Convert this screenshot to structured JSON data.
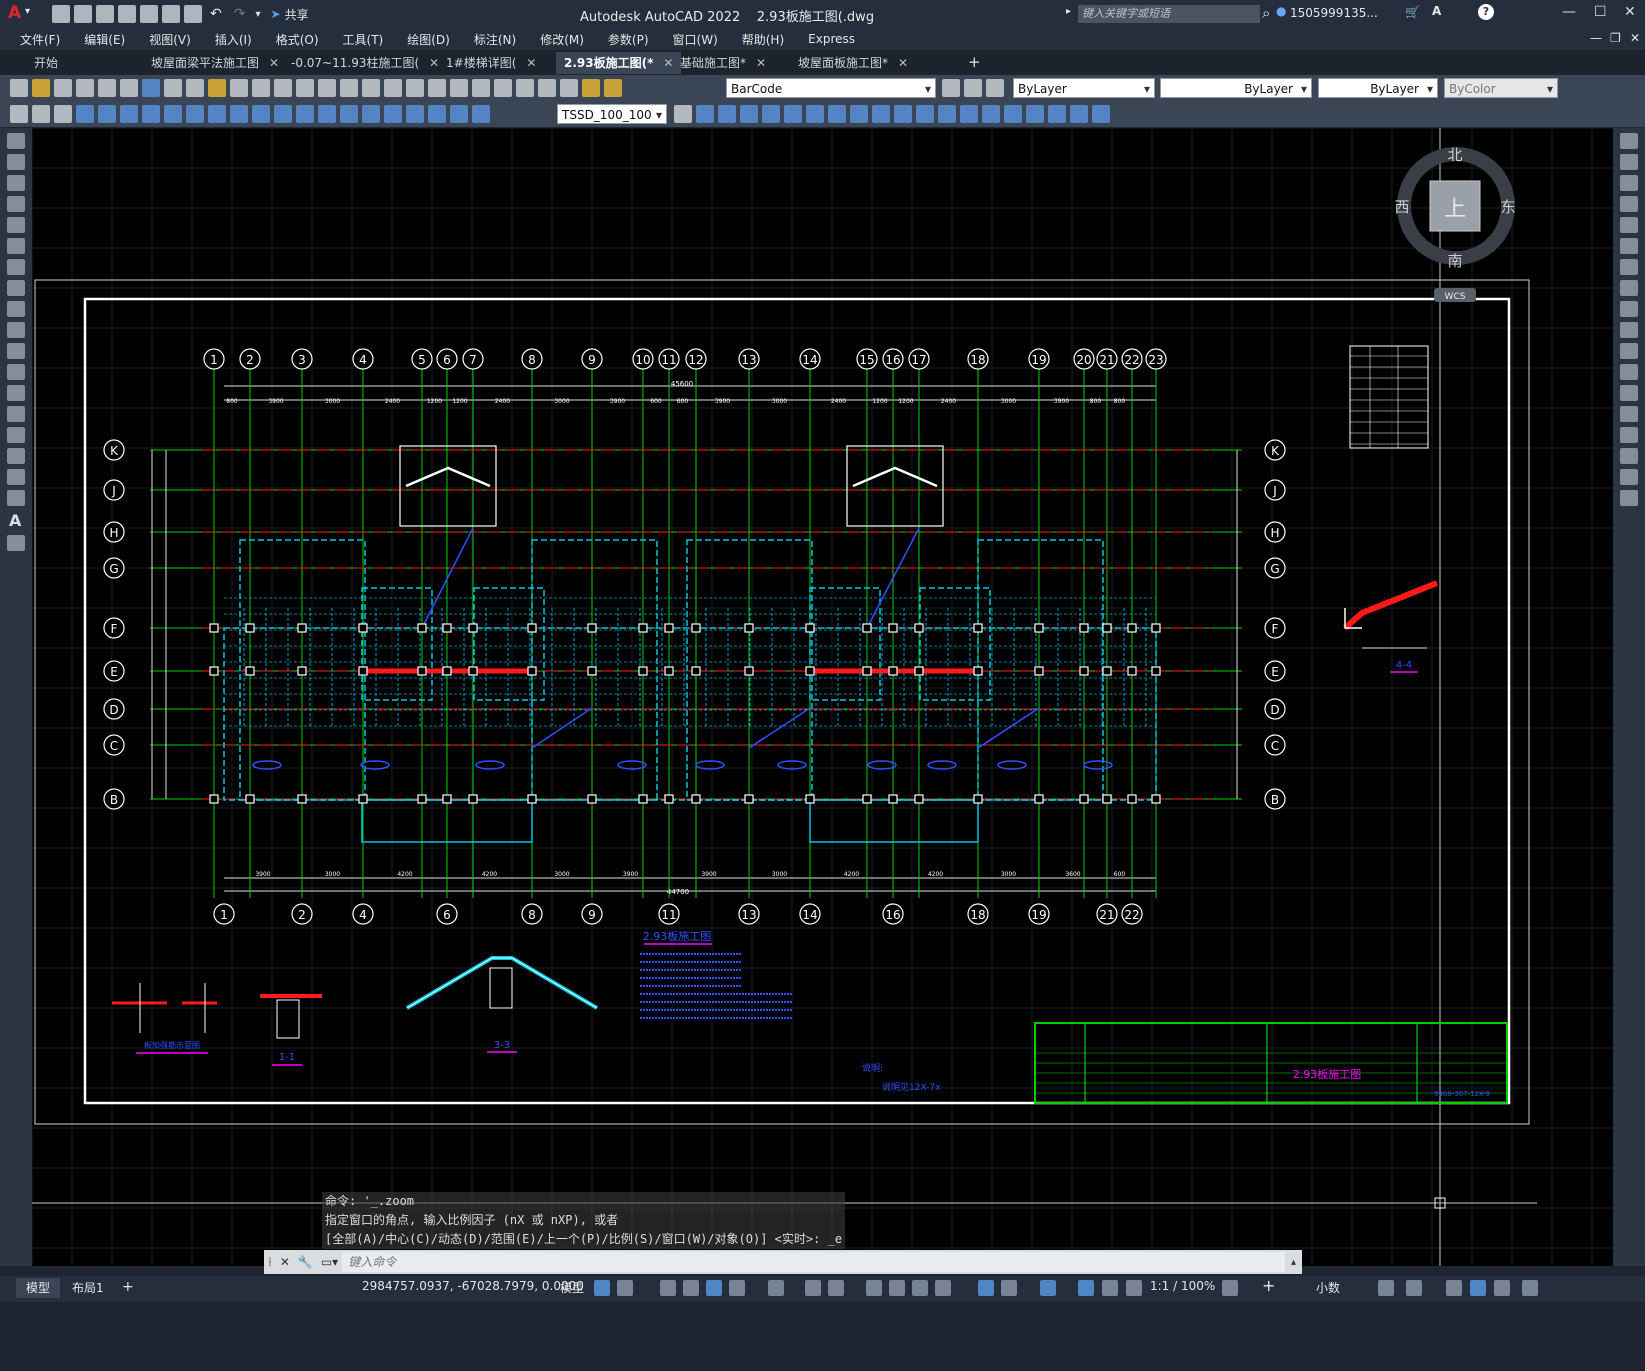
{
  "app": {
    "window_title": "Autodesk AutoCAD 2022",
    "file_name": "2.93板施工图(.dwg",
    "share": "共享"
  },
  "search": {
    "placeholder": "键入关键字或短语"
  },
  "user": {
    "name": "1505999135..."
  },
  "menu": [
    "文件(F)",
    "编辑(E)",
    "视图(V)",
    "插入(I)",
    "格式(O)",
    "工具(T)",
    "绘图(D)",
    "标注(N)",
    "修改(M)",
    "参数(P)",
    "窗口(W)",
    "帮助(H)",
    "Express"
  ],
  "tabs": [
    {
      "label": "开始",
      "active": false
    },
    {
      "label": "坡屋面梁平法施工图",
      "active": false
    },
    {
      "label": "-0.07~11.93柱施工图(",
      "active": false
    },
    {
      "label": "1#楼梯详图(",
      "active": false
    },
    {
      "label": "2.93板施工图(*",
      "active": true
    },
    {
      "label": "基础施工图*",
      "active": false
    },
    {
      "label": "坡屋面板施工图*",
      "active": false
    }
  ],
  "toolbar": {
    "layer": "BarCode",
    "color": "ByLayer",
    "linetype": "ByLayer",
    "lineweight": "ByLayer",
    "plotstyle": "ByColor",
    "dimstyle": "TSSD_100_100"
  },
  "viewcube": {
    "north": "北",
    "south": "南",
    "east": "东",
    "west": "西",
    "top": "上",
    "wcs": "WCS"
  },
  "drawing": {
    "grid_top": [
      "1",
      "2",
      "3",
      "4",
      "5",
      "6",
      "7",
      "8",
      "9",
      "10",
      "11",
      "12",
      "13",
      "14",
      "15",
      "16",
      "17",
      "18",
      "19",
      "20",
      "21",
      "22",
      "23"
    ],
    "grid_bottom": [
      "1",
      "2",
      "4",
      "6",
      "8",
      "9",
      "11",
      "13",
      "14",
      "16",
      "18",
      "19",
      "21",
      "22"
    ],
    "grid_rows": [
      "K",
      "J",
      "H",
      "G",
      "F",
      "E",
      "D",
      "C",
      "B"
    ],
    "overall_top": "45600",
    "overall_bottom": "44700",
    "dims_top": [
      "800",
      "3900",
      "3000",
      "2400",
      "1200",
      "1200",
      "2400",
      "3000",
      "3900",
      "600",
      "600",
      "3900",
      "3000",
      "2400",
      "1200",
      "1200",
      "2400",
      "3000",
      "3900",
      "800",
      "800"
    ],
    "dims_bottom": [
      "3900",
      "3000",
      "4200",
      "4200",
      "3000",
      "3900",
      "3900",
      "3000",
      "4200",
      "4200",
      "3000",
      "3600",
      "600"
    ],
    "title_block": "2.93板施工图",
    "drawing_no": "9908-307-12K-9",
    "section_44": "4-4",
    "section_33": "3-3",
    "section_11": "1-1",
    "plan_title": "2.93板施工图",
    "note_a": "板加强筋示意图",
    "note_b": "说明:",
    "note_c": "说明见12X-7x"
  },
  "command": {
    "history": [
      "命令: '_.zoom",
      "指定窗口的角点, 输入比例因子 (nX 或 nXP), 或者",
      "[全部(A)/中心(C)/动态(D)/范围(E)/上一个(P)/比例(S)/窗口(W)/对象(O)] <实时>: _e"
    ],
    "placeholder": "键入命令"
  },
  "status": {
    "layouts": [
      "模型",
      "布局1"
    ],
    "coords": "2984757.0937, -67028.7979, 0.0000",
    "space": "模型",
    "scale": "1:1 / 100%",
    "units": "小数"
  }
}
